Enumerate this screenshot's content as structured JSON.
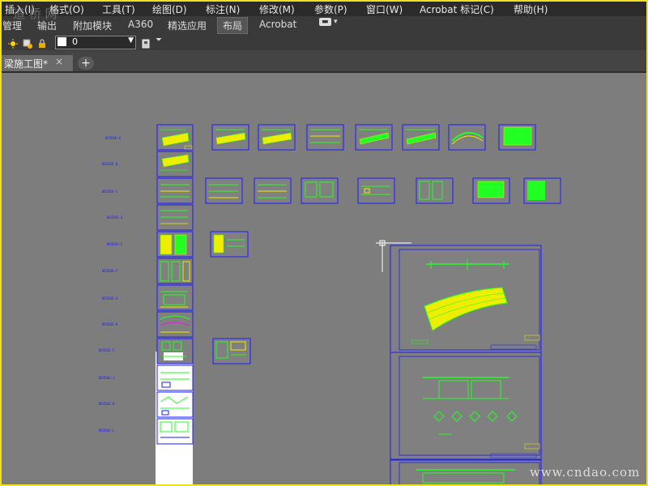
{
  "menu": [
    "插入(I)",
    "格式(O)",
    "工具(T)",
    "绘图(D)",
    "标注(N)",
    "修改(M)",
    "参数(P)",
    "窗口(W)",
    "Acrobat 标记(C)",
    "帮助(H)"
  ],
  "ribbon_tabs": [
    "管理",
    "输出",
    "附加模块",
    "A360",
    "精选应用",
    "布局",
    "Acrobat"
  ],
  "active_ribbon_tab": "布局",
  "layer": {
    "name": "0",
    "color": "#ffffff"
  },
  "document_tab": {
    "title": "梁施工图*",
    "close": "×",
    "new": "+"
  },
  "sheet_labels": [
    "BRIDGE-A",
    "BRIDGE-B",
    "BRIDGE-C",
    "BRIDGE-D",
    "BRIDGE-E",
    "BRIDGE-F",
    "BRIDGE-G",
    "BRIDGE-H",
    "BRIDGE-I",
    "BRIDGE-J",
    "BRIDGE-K",
    "BRIDGE-L"
  ],
  "watermark": "www.cndao.com",
  "logo_text": "道 桥 网",
  "colors": {
    "accent_yellow": "#f0e020",
    "sheet_border": "#1a1aff",
    "drawing_green": "#22ff22",
    "drawing_yellow": "#eeee00",
    "canvas_bg": "#7d7d7d"
  }
}
